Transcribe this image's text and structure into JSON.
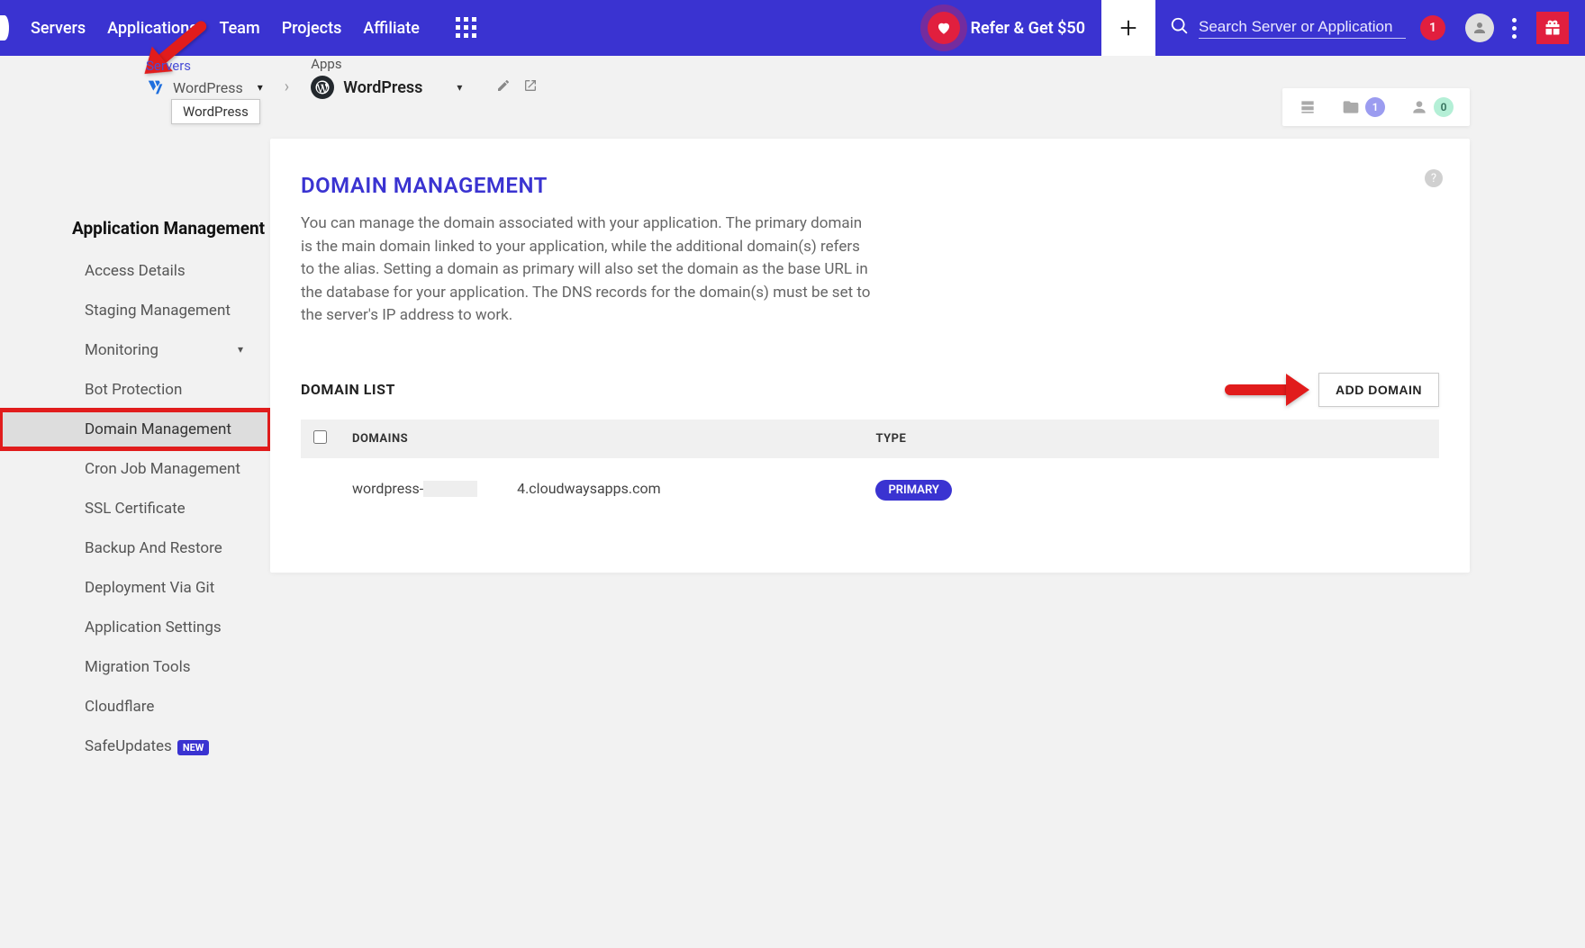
{
  "topnav": {
    "items": [
      "Servers",
      "Applications",
      "Team",
      "Projects",
      "Affiliate"
    ],
    "refer_label": "Refer & Get $50",
    "search_placeholder": "Search Server or Application",
    "notif_count": "1"
  },
  "breadcrumb": {
    "servers_label": "Servers",
    "server_name": "WordPress",
    "tooltip": "WordPress",
    "apps_label": "Apps",
    "app_name": "WordPress"
  },
  "stats": {
    "folders": "1",
    "users": "0"
  },
  "sidebar": {
    "heading": "Application Management",
    "items": [
      {
        "label": "Access Details"
      },
      {
        "label": "Staging Management"
      },
      {
        "label": "Monitoring",
        "expandable": true
      },
      {
        "label": "Bot Protection"
      },
      {
        "label": "Domain Management",
        "active": true,
        "highlighted": true
      },
      {
        "label": "Cron Job Management"
      },
      {
        "label": "SSL Certificate"
      },
      {
        "label": "Backup And Restore"
      },
      {
        "label": "Deployment Via Git"
      },
      {
        "label": "Application Settings"
      },
      {
        "label": "Migration Tools"
      },
      {
        "label": "Cloudflare"
      },
      {
        "label": "SafeUpdates",
        "badge": "NEW"
      }
    ]
  },
  "page": {
    "title": "DOMAIN MANAGEMENT",
    "description": "You can manage the domain associated with your application. The primary domain is the main domain linked to your application, while the additional domain(s) refers to the alias. Setting a domain as primary will also set the domain as the base URL in the database for your application. The DNS records for the domain(s) must be set to the server's IP address to work.",
    "list_heading": "DOMAIN LIST",
    "add_button": "ADD DOMAIN",
    "columns": {
      "domains": "DOMAINS",
      "type": "TYPE"
    },
    "rows": [
      {
        "domain_pre": "wordpress-",
        "domain_post": "4.cloudwaysapps.com",
        "type": "PRIMARY"
      }
    ]
  }
}
